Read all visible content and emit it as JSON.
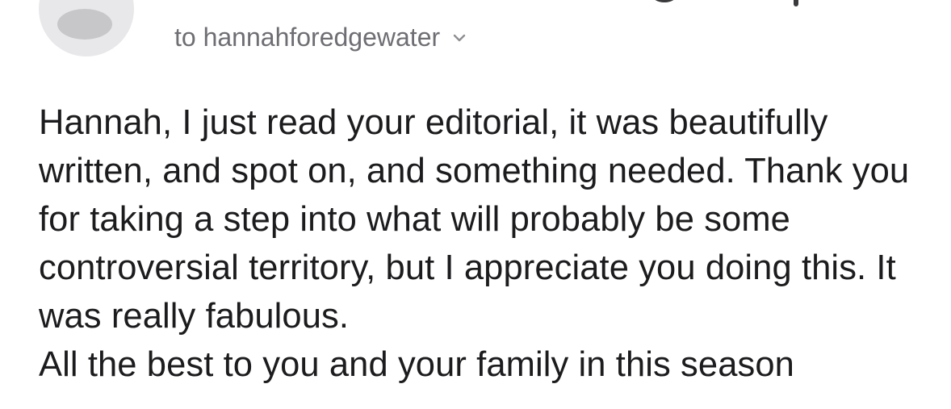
{
  "email": {
    "recipient_line": "to hannahforedgewater",
    "body_paragraphs": [
      "Hannah, I just read your editorial, it was beautifully written, and spot on, and something needed. Thank you for taking a step into what will probably be some controversial territory, but I appreciate you doing this. It was really fabulous.",
      "All the best to you and your family in this season"
    ]
  },
  "icons": {
    "avatar": "avatar-placeholder-icon",
    "top_action": "circle-icon",
    "recipient_toggle": "chevron-down-icon"
  },
  "colors": {
    "avatar_bg": "#e8e8ea",
    "avatar_fg": "#c7c7c9",
    "secondary_text": "#6e6e73",
    "body_text": "#1c1c1e"
  }
}
